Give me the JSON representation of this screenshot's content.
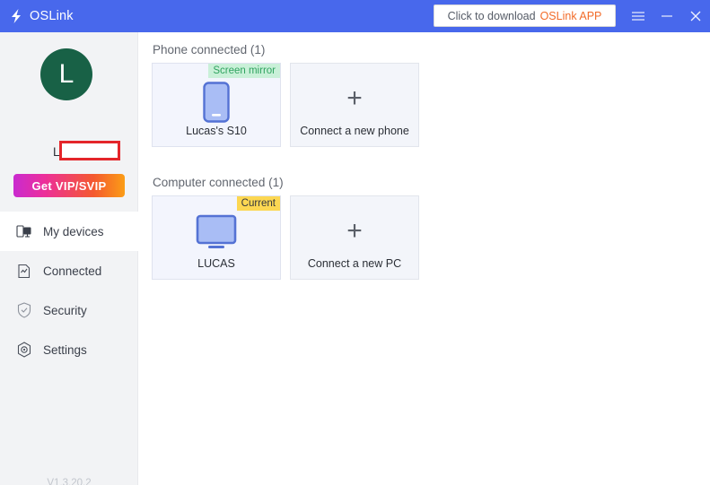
{
  "window": {
    "brand": "OSLink",
    "logo_icon": "lightning-bolt-icon",
    "download_button": {
      "text": "Click to download",
      "accent": "OSLink APP"
    },
    "controls": {
      "menu": "hamburger-menu-icon",
      "minimize": "minimize-icon",
      "close": "close-icon"
    },
    "titlebar_color": "#4868ec"
  },
  "sidebar": {
    "avatar": {
      "initial": "L",
      "color": "#186146"
    },
    "username": "Lucas",
    "vip_button": "Get VIP/SVIP",
    "items": [
      {
        "label": "My devices",
        "icon": "devices-icon",
        "active": true
      },
      {
        "label": "Connected",
        "icon": "connected-icon",
        "active": false
      },
      {
        "label": "Security",
        "icon": "shield-icon",
        "active": false
      },
      {
        "label": "Settings",
        "icon": "settings-icon",
        "active": false
      }
    ],
    "version": "V1.3.20.2"
  },
  "main": {
    "phone_section": {
      "title": "Phone connected (1)",
      "device": {
        "name": "Lucas's S10",
        "badge": "Screen mirror",
        "icon": "phone-icon"
      },
      "add": {
        "label": "Connect a new phone",
        "icon": "plus-icon"
      }
    },
    "computer_section": {
      "title": "Computer connected (1)",
      "device": {
        "name": "LUCAS",
        "badge": "Current",
        "icon": "monitor-icon"
      },
      "add": {
        "label": "Connect a new PC",
        "icon": "plus-icon"
      }
    }
  }
}
